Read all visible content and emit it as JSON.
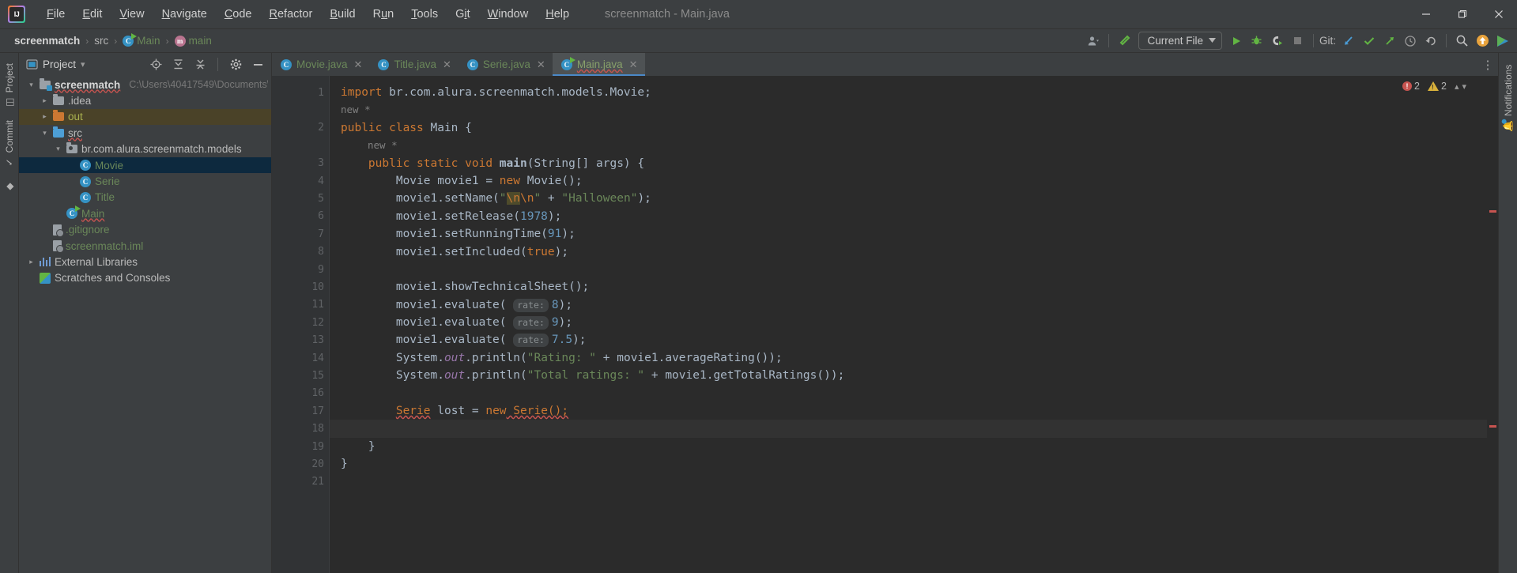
{
  "window": {
    "title": "screenmatch - Main.java",
    "minimize": "—",
    "maximize": "❐",
    "close": "✕"
  },
  "menu": {
    "items": [
      {
        "pre": "",
        "key": "F",
        "post": "ile"
      },
      {
        "pre": "",
        "key": "E",
        "post": "dit"
      },
      {
        "pre": "",
        "key": "V",
        "post": "iew"
      },
      {
        "pre": "",
        "key": "N",
        "post": "avigate"
      },
      {
        "pre": "",
        "key": "C",
        "post": "ode"
      },
      {
        "pre": "",
        "key": "R",
        "post": "efactor"
      },
      {
        "pre": "",
        "key": "B",
        "post": "uild"
      },
      {
        "pre": "R",
        "key": "u",
        "post": "n"
      },
      {
        "pre": "",
        "key": "T",
        "post": "ools"
      },
      {
        "pre": "G",
        "key": "i",
        "post": "t"
      },
      {
        "pre": "",
        "key": "W",
        "post": "indow"
      },
      {
        "pre": "",
        "key": "H",
        "post": "elp"
      }
    ]
  },
  "breadcrumbs": [
    {
      "label": "screenmatch",
      "style": "bold"
    },
    {
      "label": "src",
      "style": "plain"
    },
    {
      "label": "Main",
      "style": "green",
      "icon": "class-icon"
    },
    {
      "label": "main",
      "style": "green",
      "icon": "method-icon"
    }
  ],
  "toolbar": {
    "account_label": "account-icon",
    "build_label": "build-hammer-icon",
    "run_config": "Current File",
    "run_label": "run-icon",
    "debug_label": "debug-icon",
    "coverage_label": "run-with-coverage-icon",
    "stop_label": "stop-icon",
    "git_label": "Git:",
    "git_update": "update-project-icon",
    "git_commit": "commit-icon",
    "git_push": "push-icon",
    "history": "history-icon",
    "rollback": "rollback-icon",
    "search": "search-icon",
    "updates": "updates-available-icon",
    "services": "ide-services-icon"
  },
  "leftbar": {
    "tabs": [
      {
        "label": "Project",
        "icon": "project-icon"
      },
      {
        "label": "Commit",
        "icon": "commit-icon"
      },
      {
        "label": "",
        "icon": "pull-requests-icon"
      }
    ]
  },
  "rightbar": {
    "tabs": [
      {
        "label": "Notifications",
        "icon": "notifications-bell-icon"
      }
    ]
  },
  "project_panel": {
    "title": "Project",
    "dropdown": "▾",
    "locate_icon": "locate-file-icon",
    "expand_icon": "expand-all-icon",
    "collapse_icon": "collapse-all-icon",
    "settings_icon": "gear-icon",
    "hide_icon": "hide-icon",
    "tree": [
      {
        "label": "screenmatch",
        "path": "C:\\Users\\40417549\\Documents\\(",
        "indent": 0,
        "twisty": "⌄",
        "icon": "module-folder-icon",
        "style": "bold",
        "state": "normal",
        "squiggle": true
      },
      {
        "label": ".idea",
        "path": "",
        "indent": 1,
        "twisty": "›",
        "icon": "folder-grey-icon",
        "style": "normal",
        "state": "normal",
        "squiggle": false
      },
      {
        "label": "out",
        "path": "",
        "indent": 1,
        "twisty": "›",
        "icon": "folder-orange-icon",
        "style": "orange",
        "state": "highlight",
        "squiggle": false
      },
      {
        "label": "src",
        "path": "",
        "indent": 1,
        "twisty": "⌄",
        "icon": "folder-blue-icon",
        "style": "normal",
        "state": "normal",
        "squiggle": true
      },
      {
        "label": "br.com.alura.screenmatch.models",
        "path": "",
        "indent": 2,
        "twisty": "⌄",
        "icon": "package-icon",
        "style": "normal",
        "state": "normal",
        "squiggle": false
      },
      {
        "label": "Movie",
        "path": "",
        "indent": 3,
        "twisty": "",
        "icon": "class-icon",
        "style": "green",
        "state": "selected",
        "squiggle": false
      },
      {
        "label": "Serie",
        "path": "",
        "indent": 3,
        "twisty": "",
        "icon": "class-icon",
        "style": "green",
        "state": "normal",
        "squiggle": false
      },
      {
        "label": "Title",
        "path": "",
        "indent": 3,
        "twisty": "",
        "icon": "class-icon",
        "style": "green",
        "state": "normal",
        "squiggle": false
      },
      {
        "label": "Main",
        "path": "",
        "indent": 2,
        "twisty": "",
        "icon": "runnable-class-icon",
        "style": "green",
        "state": "normal",
        "squiggle": true
      },
      {
        "label": ".gitignore",
        "path": "",
        "indent": 1,
        "twisty": "",
        "icon": "gitignore-file-icon",
        "style": "green",
        "state": "normal",
        "squiggle": false
      },
      {
        "label": "screenmatch.iml",
        "path": "",
        "indent": 1,
        "twisty": "",
        "icon": "iml-file-icon",
        "style": "green",
        "state": "normal",
        "squiggle": false
      },
      {
        "label": "External Libraries",
        "path": "",
        "indent": 0,
        "twisty": "›",
        "icon": "libraries-icon",
        "style": "normal",
        "state": "normal",
        "squiggle": false
      },
      {
        "label": "Scratches and Consoles",
        "path": "",
        "indent": 0,
        "twisty": "",
        "icon": "scratches-icon",
        "style": "normal",
        "state": "normal",
        "squiggle": false
      }
    ]
  },
  "editor": {
    "tabs": [
      {
        "label": "Movie.java",
        "active": false,
        "close": "✕",
        "icon": "java-class-icon"
      },
      {
        "label": "Title.java",
        "active": false,
        "close": "✕",
        "icon": "java-class-icon"
      },
      {
        "label": "Serie.java",
        "active": false,
        "close": "✕",
        "icon": "java-class-icon"
      },
      {
        "label": "Main.java",
        "active": true,
        "close": "✕",
        "icon": "java-class-icon"
      }
    ],
    "kebab": "⋮",
    "inspection": {
      "error_count": "2",
      "warning_count": "2",
      "error_glyph": "!",
      "chevron_up": "▴",
      "chevron_down": "▾"
    },
    "line_numbers": [
      "1",
      "2",
      "3",
      "4",
      "5",
      "6",
      "7",
      "8",
      "9",
      "10",
      "11",
      "12",
      "13",
      "14",
      "15",
      "16",
      "17",
      "18",
      "19",
      "20",
      "21"
    ],
    "inlay_codevision": "new *",
    "hint_rate": "rate:",
    "code": {
      "l1_import": "import",
      "l1_pkg": " br.com.alura.screenmatch.models.Movie;",
      "l2_a": "public class",
      "l2_b": " Main {",
      "l3_a": "public static void",
      "l3_b": " main",
      "l3_c": "(String[] args) {",
      "l4_a": "Movie movie1 = ",
      "l4_new": "new",
      "l4_b": " Movie();",
      "l5_a": "movie1.setName(",
      "l5_q1": "\"",
      "l5_esc1": "\\n",
      "l5_esc2": "\\n",
      "l5_q2": "\"",
      "l5_plus": " + ",
      "l5_str": "\"Halloween\"",
      "l5_end": ");",
      "l6_a": "movie1.setRelease(",
      "l6_n": "1978",
      "l6_b": ");",
      "l7_a": "movie1.setRunningTime(",
      "l7_n": "91",
      "l7_b": ");",
      "l8_a": "movie1.setIncluded(",
      "l8_n": "true",
      "l8_b": ");",
      "l10": "movie1.showTechnicalSheet();",
      "l11_a": "movie1.evaluate( ",
      "l11_n": "8",
      "l11_b": ");",
      "l12_n": "9",
      "l13_n": "7.5",
      "l14_a": "System.",
      "l14_out": "out",
      "l14_b": ".println(",
      "l14_s": "\"Rating: \"",
      "l14_c": " + movie1.averageRating());",
      "l15_s": "\"Total ratings: \"",
      "l15_c": " + movie1.getTotalRatings());",
      "l17_a": "Serie",
      "l17_b": " lost = ",
      "l17_new": "new",
      "l17_c": " Serie();",
      "l19": "}",
      "l20": "}"
    }
  },
  "colors": {
    "accent_blue": "#4a88c7",
    "keyword_orange": "#cc7832",
    "string_green": "#6a8759",
    "number_blue": "#6897bb",
    "field_purple": "#9876aa",
    "error_red": "#c75450",
    "warning_yellow": "#d9b13b",
    "selection_blue": "#0d293e",
    "panel_bg": "#3c3f41",
    "editor_bg": "#2b2b2b"
  }
}
